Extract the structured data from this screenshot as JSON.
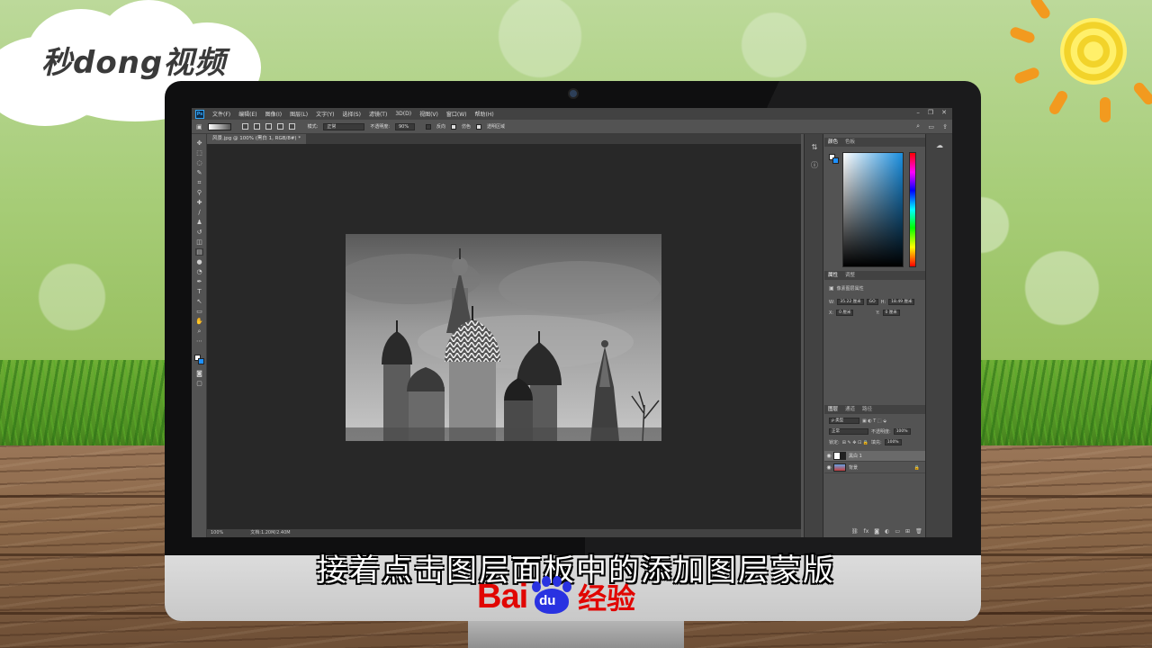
{
  "brand_logo": {
    "text": "秒dong视频"
  },
  "photoshop": {
    "menu": [
      "文件(F)",
      "编辑(E)",
      "图像(I)",
      "图层(L)",
      "文字(Y)",
      "选择(S)",
      "滤镜(T)",
      "3D(D)",
      "视图(V)",
      "窗口(W)",
      "帮助(H)"
    ],
    "app_icon": "Ps",
    "options_bar": {
      "mode_label": "模式:",
      "mode_value": "正常",
      "opacity_label": "不透明度:",
      "opacity_value": "90%",
      "reverse_label": "反向",
      "dither_label": "仿色",
      "transparency_label": "透明区域"
    },
    "document_tab": "风景.jpg @ 100% (黑白 1, RGB/8#) *",
    "status": {
      "zoom": "100%",
      "doc_size": "文档:1.20M/2.40M"
    },
    "color_panel": {
      "tabs": [
        "颜色",
        "色板"
      ],
      "foreground": "#ffffff",
      "background": "#1e90ff"
    },
    "properties_panel": {
      "tabs": [
        "属性",
        "调整"
      ],
      "title": "像素图层属性",
      "w_label": "W:",
      "w_value": "35.22 厘米",
      "link_label": "GO",
      "h_label": "H:",
      "h_value": "18.49 厘米",
      "x_label": "X:",
      "x_value": "0 厘米",
      "y_label": "Y:",
      "y_value": "0 厘米"
    },
    "layers_panel": {
      "tabs": [
        "图层",
        "通道",
        "路径"
      ],
      "filter_label": "ρ 类型",
      "blend_mode": "正常",
      "opacity_label": "不透明度:",
      "opacity_value": "100%",
      "lock_label": "锁定:",
      "fill_label": "填充:",
      "fill_value": "100%",
      "layers": [
        {
          "name": "黑白 1",
          "selected": true
        },
        {
          "name": "背景",
          "selected": false
        }
      ]
    }
  },
  "subtitle": "接着点击图层面板中的添加图层蒙版",
  "watermark": {
    "bai": "Bai",
    "du": "du",
    "jingyan": "经验"
  }
}
